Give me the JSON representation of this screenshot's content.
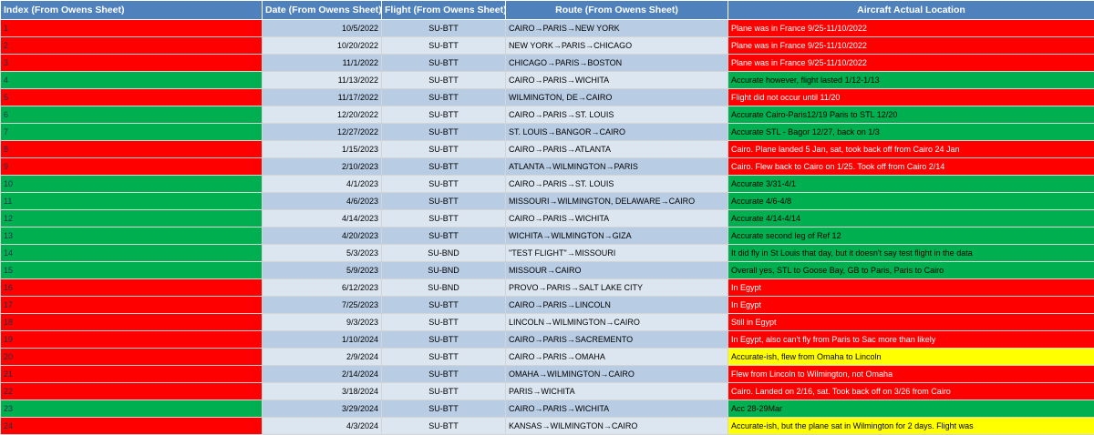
{
  "headers": {
    "index": "Index (From Owens Sheet)",
    "date": "Date (From Owens Sheet)",
    "flight": "Flight (From Owens Sheet)",
    "route": "Route (From Owens Sheet)",
    "location": "Aircraft Actual Location"
  },
  "colors": {
    "header": "#4f81bd",
    "red": "#ff0000",
    "green": "#00b050",
    "yellow": "#ffff00",
    "band_dark": "#b8cce4",
    "band_light": "#dce6f1"
  },
  "rows": [
    {
      "index": "1",
      "date": "10/5/2022",
      "flight": "SU-BTT",
      "route": "CAIRO→PARIS→NEW YORK",
      "location": "Plane was in France 9/25-11/10/2022",
      "status": "red",
      "loc_color": "red"
    },
    {
      "index": "2",
      "date": "10/20/2022",
      "flight": "SU-BTT",
      "route": "NEW YORK→PARIS→CHICAGO",
      "location": "Plane was in France 9/25-11/10/2022",
      "status": "red",
      "loc_color": "red"
    },
    {
      "index": "3",
      "date": "11/1/2022",
      "flight": "SU-BTT",
      "route": "CHICAGO→PARIS→BOSTON",
      "location": "Plane was in France 9/25-11/10/2022",
      "status": "red",
      "loc_color": "red"
    },
    {
      "index": "4",
      "date": "11/13/2022",
      "flight": "SU-BTT",
      "route": "CAIRO→PARIS→WICHITA",
      "location": "Accurate however, flight lasted 1/12-1/13",
      "status": "green",
      "loc_color": "green"
    },
    {
      "index": "5",
      "date": "11/17/2022",
      "flight": "SU-BTT",
      "route": "WILMINGTON, DE→CAIRO",
      "location": "Flight did not occur until 11/20",
      "status": "red",
      "loc_color": "red"
    },
    {
      "index": "6",
      "date": "12/20/2022",
      "flight": "SU-BTT",
      "route": "CAIRO→PARIS→ST. LOUIS",
      "location": "Accurate Cairo-Paris12/19 Paris to STL 12/20",
      "status": "green",
      "loc_color": "green"
    },
    {
      "index": "7",
      "date": "12/27/2022",
      "flight": "SU-BTT",
      "route": "ST. LOUIS→BANGOR→CAIRO",
      "location": "Accurate STL - Bagor 12/27, back on 1/3",
      "status": "green",
      "loc_color": "green"
    },
    {
      "index": "8",
      "date": "1/15/2023",
      "flight": "SU-BTT",
      "route": "CAIRO→PARIS→ATLANTA",
      "location": "Cairo. Plane landed 5 Jan, sat, took back off from Cairo 24 Jan",
      "status": "red",
      "loc_color": "red"
    },
    {
      "index": "9",
      "date": "2/10/2023",
      "flight": "SU-BTT",
      "route": "ATLANTA→WILMINGTON→PARIS",
      "location": "Cairo. Flew back to Cairo on 1/25. Took off from Cairo 2/14",
      "status": "red",
      "loc_color": "red"
    },
    {
      "index": "10",
      "date": "4/1/2023",
      "flight": "SU-BTT",
      "route": "CAIRO→PARIS→ST. LOUIS",
      "location": "Accurate 3/31-4/1",
      "status": "green",
      "loc_color": "green"
    },
    {
      "index": "11",
      "date": "4/6/2023",
      "flight": "SU-BTT",
      "route": "MISSOURI→WILMINGTON, DELAWARE→CAIRO",
      "location": "Accurate 4/6-4/8",
      "status": "green",
      "loc_color": "green"
    },
    {
      "index": "12",
      "date": "4/14/2023",
      "flight": "SU-BTT",
      "route": "CAIRO→PARIS→WICHITA",
      "location": "Accurate 4/14-4/14",
      "status": "green",
      "loc_color": "green"
    },
    {
      "index": "13",
      "date": "4/20/2023",
      "flight": "SU-BTT",
      "route": "WICHITA→WILMINGTON→GIZA",
      "location": "Accurate second leg of Ref 12",
      "status": "green",
      "loc_color": "green"
    },
    {
      "index": "14",
      "date": "5/3/2023",
      "flight": "SU-BND",
      "route": "\"TEST FLIGHT\"→MISSOURI",
      "location": "It did fly in St Louis that day, but it doesn't say test flight in the data",
      "status": "green",
      "loc_color": "green"
    },
    {
      "index": "15",
      "date": "5/9/2023",
      "flight": "SU-BND",
      "route": "MISSOUR→CAIRO",
      "location": "Overall yes, STL to Goose Bay, GB to Paris, Paris to Cairo",
      "status": "green",
      "loc_color": "green"
    },
    {
      "index": "16",
      "date": "6/12/2023",
      "flight": "SU-BND",
      "route": "PROVO→PARIS→SALT LAKE CITY",
      "location": "In Egypt",
      "status": "red",
      "loc_color": "red"
    },
    {
      "index": "17",
      "date": "7/25/2023",
      "flight": "SU-BTT",
      "route": "CAIRO→PARIS→LINCOLN",
      "location": "In Egypt",
      "status": "red",
      "loc_color": "red"
    },
    {
      "index": "18",
      "date": "9/3/2023",
      "flight": "SU-BTT",
      "route": "LINCOLN→WILMINGTON→CAIRO",
      "location": "Still in Egypt",
      "status": "red",
      "loc_color": "red"
    },
    {
      "index": "19",
      "date": "1/10/2024",
      "flight": "SU-BTT",
      "route": "CAIRO→PARIS→SACREMENTO",
      "location": "In Egypt, also can't fly from Paris to Sac more than likely",
      "status": "red",
      "loc_color": "red"
    },
    {
      "index": "20",
      "date": "2/9/2024",
      "flight": "SU-BTT",
      "route": "CAIRO→PARIS→OMAHA",
      "location": "Accurate-ish, flew from Omaha to Lincoln",
      "status": "red",
      "loc_color": "yellow"
    },
    {
      "index": "21",
      "date": "2/14/2024",
      "flight": "SU-BTT",
      "route": "OMAHA→WILMINGTON→CAIRO",
      "location": "Flew from Lincoln to Wilmington, not Omaha",
      "status": "red",
      "loc_color": "red"
    },
    {
      "index": "22",
      "date": "3/18/2024",
      "flight": "SU-BTT",
      "route": "PARIS→WICHITA",
      "location": "Cairo. Landed on 2/16, sat. Took back off on 3/26 from Cairo",
      "status": "red",
      "loc_color": "red"
    },
    {
      "index": "23",
      "date": "3/29/2024",
      "flight": "SU-BTT",
      "route": "CAIRO→PARIS→WICHITA",
      "location": "Acc 28-29Mar",
      "status": "green",
      "loc_color": "green"
    },
    {
      "index": "24",
      "date": "4/3/2024",
      "flight": "SU-BTT",
      "route": "KANSAS→WILMINGTON→CAIRO",
      "location": "Accurate-ish, but the plane sat in Wilmington for 2 days. Flight was",
      "status": "red",
      "loc_color": "yellow"
    }
  ]
}
